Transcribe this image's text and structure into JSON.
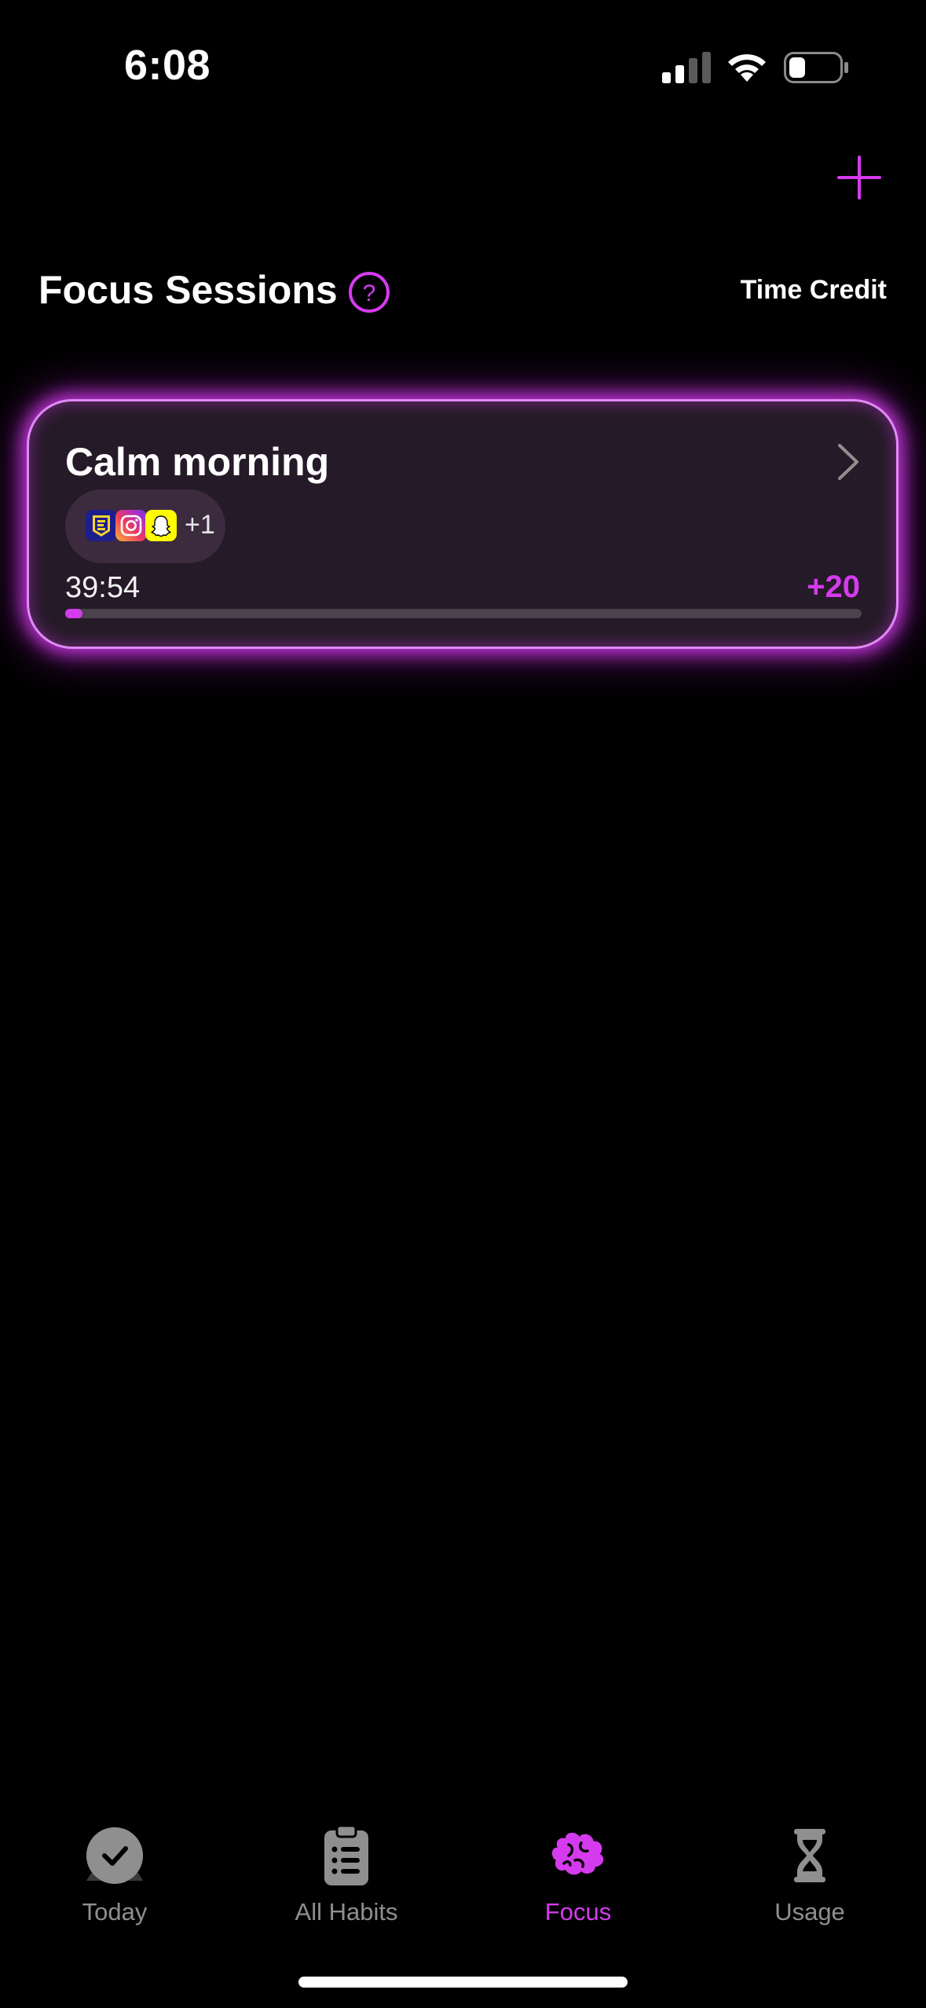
{
  "status_bar": {
    "time": "6:08"
  },
  "header": {
    "title": "Focus Sessions",
    "time_credit_label": "Time Credit"
  },
  "sessions": [
    {
      "name": "Calm morning",
      "apps": [
        "app-e-icon",
        "instagram-icon",
        "snapchat-icon"
      ],
      "extra_apps": "+1",
      "timer": "39:54",
      "credit": "+20",
      "progress": 0.02
    }
  ],
  "tabs": [
    {
      "label": "Today",
      "icon": "clock-check-icon",
      "active": false
    },
    {
      "label": "All Habits",
      "icon": "clipboard-list-icon",
      "active": false
    },
    {
      "label": "Focus",
      "icon": "brain-icon",
      "active": true
    },
    {
      "label": "Usage",
      "icon": "hourglass-icon",
      "active": false
    }
  ],
  "colors": {
    "accent": "#d53bee",
    "background": "#000000",
    "inactive": "#8f8f8f"
  }
}
